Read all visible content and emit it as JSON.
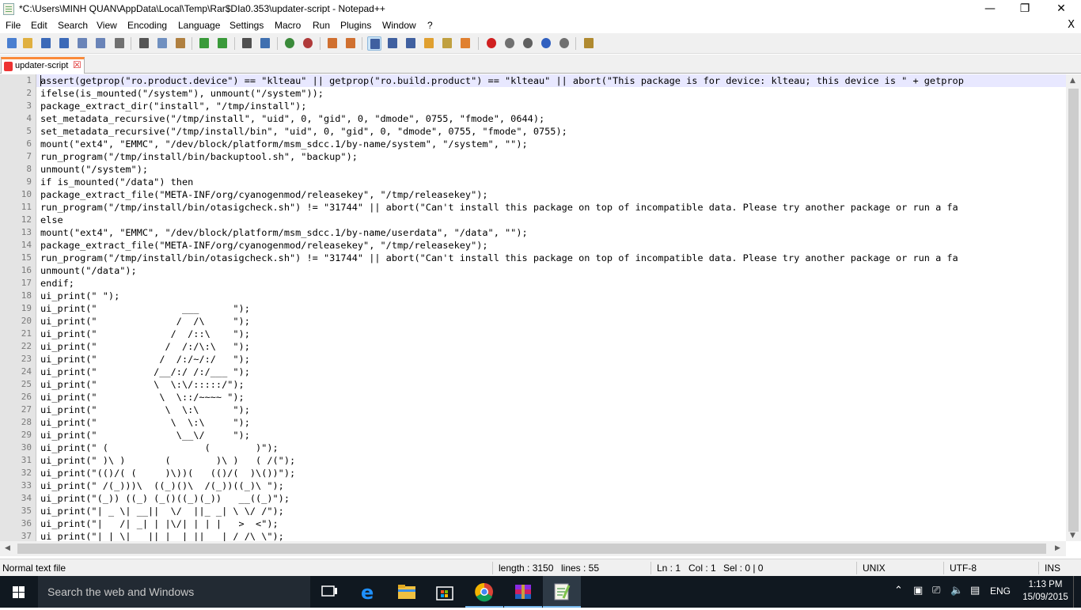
{
  "window": {
    "title": "*C:\\Users\\MINH QUAN\\AppData\\Local\\Temp\\Rar$DIa0.353\\updater-script - Notepad++",
    "minimize_glyph": "—",
    "restore_glyph": "❐",
    "close_glyph": "✕"
  },
  "menu": {
    "items": [
      "File",
      "Edit",
      "Search",
      "View",
      "Encoding",
      "Language",
      "Settings",
      "Macro",
      "Run",
      "Plugins",
      "Window",
      "?"
    ],
    "close_glyph": "X"
  },
  "toolbar": {
    "buttons": [
      {
        "icon": "new-file-icon",
        "color": "#4a7fd0"
      },
      {
        "icon": "open-file-icon",
        "color": "#e0b040"
      },
      {
        "icon": "save-icon",
        "color": "#3c6ab8"
      },
      {
        "icon": "save-all-icon",
        "color": "#3c6ab8"
      },
      {
        "icon": "close-file-icon",
        "color": "#6a84b8"
      },
      {
        "icon": "close-all-icon",
        "color": "#6a84b8"
      },
      {
        "icon": "print-icon",
        "color": "#707070"
      },
      {
        "icon": "cut-icon",
        "color": "#555555"
      },
      {
        "icon": "copy-icon",
        "color": "#7090c0"
      },
      {
        "icon": "paste-icon",
        "color": "#b08040"
      },
      {
        "icon": "undo-icon",
        "color": "#3a9a3a"
      },
      {
        "icon": "redo-icon",
        "color": "#3a9a3a"
      },
      {
        "icon": "find-icon",
        "color": "#505050"
      },
      {
        "icon": "replace-icon",
        "color": "#4070b0"
      },
      {
        "icon": "zoom-in-icon",
        "color": "#3a8a3a"
      },
      {
        "icon": "zoom-out-icon",
        "color": "#b03a3a"
      },
      {
        "icon": "sync-vertical-icon",
        "color": "#d07030"
      },
      {
        "icon": "sync-horizontal-icon",
        "color": "#d07030"
      },
      {
        "icon": "word-wrap-icon",
        "color": "#4060a0"
      },
      {
        "icon": "show-all-chars-icon",
        "color": "#4060a0"
      },
      {
        "icon": "indent-guide-icon",
        "color": "#4060a0"
      },
      {
        "icon": "document-map-icon",
        "color": "#e0a030"
      },
      {
        "icon": "function-list-icon",
        "color": "#c0a040"
      },
      {
        "icon": "folder-workspace-icon",
        "color": "#e08030"
      },
      {
        "icon": "record-macro-icon",
        "color": "#d02020"
      },
      {
        "icon": "stop-macro-icon",
        "color": "#707070"
      },
      {
        "icon": "play-macro-icon",
        "color": "#606060"
      },
      {
        "icon": "run-macro-multiple-icon",
        "color": "#3060c0"
      },
      {
        "icon": "save-macro-icon",
        "color": "#707070"
      },
      {
        "icon": "plugin-icon",
        "color": "#b08a30"
      }
    ]
  },
  "tab": {
    "label": "updater-script",
    "close_glyph": "☒",
    "accent": "#fa8a3a"
  },
  "editor": {
    "line_numbers": [
      "1",
      "2",
      "3",
      "4",
      "5",
      "6",
      "7",
      "8",
      "9",
      "10",
      "11",
      "12",
      "13",
      "14",
      "15",
      "16",
      "17",
      "18",
      "19",
      "20",
      "21",
      "22",
      "23",
      "24",
      "25",
      "26",
      "27",
      "28",
      "29",
      "30",
      "31",
      "32",
      "33",
      "34",
      "35",
      "36",
      "37"
    ],
    "lines": [
      "assert(getprop(\"ro.product.device\") == \"klteau\" || getprop(\"ro.build.product\") == \"klteau\" || abort(\"This package is for device: klteau; this device is \" + getprop",
      "ifelse(is_mounted(\"/system\"), unmount(\"/system\"));",
      "package_extract_dir(\"install\", \"/tmp/install\");",
      "set_metadata_recursive(\"/tmp/install\", \"uid\", 0, \"gid\", 0, \"dmode\", 0755, \"fmode\", 0644);",
      "set_metadata_recursive(\"/tmp/install/bin\", \"uid\", 0, \"gid\", 0, \"dmode\", 0755, \"fmode\", 0755);",
      "mount(\"ext4\", \"EMMC\", \"/dev/block/platform/msm_sdcc.1/by-name/system\", \"/system\", \"\");",
      "run_program(\"/tmp/install/bin/backuptool.sh\", \"backup\");",
      "unmount(\"/system\");",
      "if is_mounted(\"/data\") then",
      "package_extract_file(\"META-INF/org/cyanogenmod/releasekey\", \"/tmp/releasekey\");",
      "run_program(\"/tmp/install/bin/otasigcheck.sh\") != \"31744\" || abort(\"Can't install this package on top of incompatible data. Please try another package or run a fa",
      "else",
      "mount(\"ext4\", \"EMMC\", \"/dev/block/platform/msm_sdcc.1/by-name/userdata\", \"/data\", \"\");",
      "package_extract_file(\"META-INF/org/cyanogenmod/releasekey\", \"/tmp/releasekey\");",
      "run_program(\"/tmp/install/bin/otasigcheck.sh\") != \"31744\" || abort(\"Can't install this package on top of incompatible data. Please try another package or run a fa",
      "unmount(\"/data\");",
      "endif;",
      "ui_print(\" \");",
      "ui_print(\"               ___      \");",
      "ui_print(\"              /  /\\     \");",
      "ui_print(\"             /  /::\\    \");",
      "ui_print(\"            /  /:/\\:\\   \");",
      "ui_print(\"           /  /:/~/:/   \");",
      "ui_print(\"          /__/:/ /:/___ \");",
      "ui_print(\"          \\  \\:\\/:::::/\");",
      "ui_print(\"           \\  \\::/~~~~ \");",
      "ui_print(\"            \\  \\:\\      \");",
      "ui_print(\"             \\  \\:\\     \");",
      "ui_print(\"              \\__\\/     \");",
      "ui_print(\" (                 (        )\");",
      "ui_print(\" )\\ )       (        )\\ )   ( /(\");",
      "ui_print(\"(()/( (     )\\))(   (()/(  )\\())\");",
      "ui_print(\" /(_)))\\  ((_)()\\  /(_))((_)\\ \");",
      "ui_print(\"(_)) ((_) (_()((_)(_))   __((_)\");",
      "ui_print(\"| _ \\| __||  \\/  ||_ _| \\ \\/ /\");",
      "ui_print(\"|   /| _| | |\\/| | | |   >  <\");",
      "ui_print(\"|_|_\\|___||_|  |_||___| /_/\\_\\\");"
    ]
  },
  "status": {
    "file_type": "Normal text file",
    "length": "length : 3150",
    "lines": "lines : 55",
    "ln": "Ln : 1",
    "col": "Col : 1",
    "sel": "Sel : 0 | 0",
    "eol": "UNIX",
    "encoding": "UTF-8",
    "mode": "INS"
  },
  "taskbar": {
    "search_placeholder": "Search the web and Windows",
    "apps": [
      {
        "icon": "task-view-icon"
      },
      {
        "icon": "edge-icon"
      },
      {
        "icon": "file-explorer-icon"
      },
      {
        "icon": "store-icon"
      },
      {
        "icon": "chrome-icon"
      },
      {
        "icon": "winrar-icon"
      },
      {
        "icon": "notepadpp-icon"
      }
    ],
    "language": "ENG",
    "time": "1:13 PM",
    "date": "15/09/2015"
  }
}
